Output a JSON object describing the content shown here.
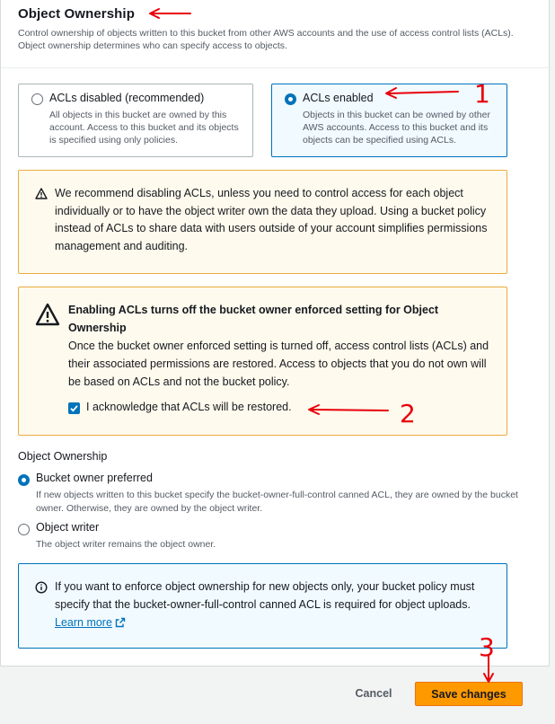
{
  "section": {
    "title": "Object Ownership",
    "description": "Control ownership of objects written to this bucket from other AWS accounts and the use of access control lists (ACLs). Object ownership determines who can specify access to objects."
  },
  "acl_tiles": [
    {
      "label": "ACLs disabled (recommended)",
      "description": "All objects in this bucket are owned by this account. Access to this bucket and its objects is specified using only policies.",
      "selected": false
    },
    {
      "label": "ACLs enabled",
      "description": "Objects in this bucket can be owned by other AWS accounts. Access to this bucket and its objects can be specified using ACLs.",
      "selected": true
    }
  ],
  "recommend_alert": {
    "text": "We recommend disabling ACLs, unless you need to control access for each object individually or to have the object writer own the data they upload. Using a bucket policy instead of ACLs to share data with users outside of your account simplifies permissions management and auditing."
  },
  "warning_alert": {
    "heading": "Enabling ACLs turns off the bucket owner enforced setting for Object Ownership",
    "body": "Once the bucket owner enforced setting is turned off, access control lists (ACLs) and their associated permissions are restored. Access to objects that you do not own will be based on ACLs and not the bucket policy.",
    "acknowledge_label": "I acknowledge that ACLs will be restored.",
    "acknowledged": true
  },
  "ownership": {
    "label": "Object Ownership",
    "options": [
      {
        "label": "Bucket owner preferred",
        "description": "If new objects written to this bucket specify the bucket-owner-full-control canned ACL, they are owned by the bucket owner. Otherwise, they are owned by the object writer.",
        "selected": true
      },
      {
        "label": "Object writer",
        "description": "The object writer remains the object owner.",
        "selected": false
      }
    ]
  },
  "info_alert": {
    "text": "If you want to enforce object ownership for new objects only, your bucket policy must specify that the bucket-owner-full-control canned ACL is required for object uploads.",
    "link": "Learn more"
  },
  "footer": {
    "cancel_label": "Cancel",
    "save_label": "Save changes"
  },
  "annotations": {
    "marks": [
      "1",
      "2",
      "3"
    ],
    "color": "#e8000b"
  },
  "colors": {
    "accent": "#0073bb",
    "primary_button": "#ff9900",
    "warning_border": "#eaac3f",
    "warning_bg": "#fefaed"
  }
}
